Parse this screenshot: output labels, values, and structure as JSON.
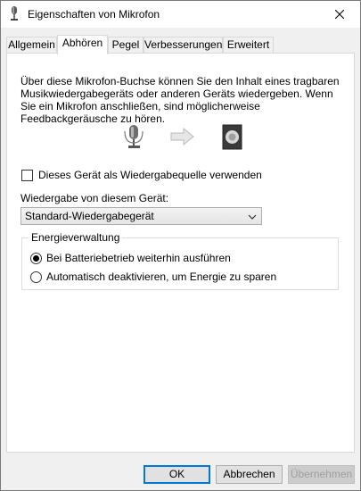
{
  "window": {
    "title": "Eigenschaften von Mikrofon",
    "icon": "microphone-icon",
    "close_icon": "close-icon"
  },
  "tabs": [
    {
      "label": "Allgemein",
      "active": false
    },
    {
      "label": "Abhören",
      "active": true
    },
    {
      "label": "Pegel",
      "active": false
    },
    {
      "label": "Verbesserungen",
      "active": false
    },
    {
      "label": "Erweitert",
      "active": false
    }
  ],
  "panel": {
    "description_line1": "Über diese Mikrofon-Buchse können Sie den Inhalt eines tragbaren",
    "description_line2": "Musikwiedergabegeräts oder anderen Geräts wiedergeben. Wenn",
    "description_line3": "Sie ein Mikrofon anschließen, sind möglicherweise",
    "description_line4": "Feedbackgeräusche zu hören.",
    "illustration": {
      "source_icon": "microphone-icon",
      "arrow_icon": "arrow-right-icon",
      "target_icon": "speaker-icon"
    },
    "checkbox_label": "Dieses Gerät als Wiedergabequelle verwenden",
    "checkbox_checked": false,
    "playback_label": "Wiedergabe von diesem Gerät:",
    "playback_selected": "Standard-Wiedergabegerät",
    "power": {
      "title": "Energieverwaltung",
      "option1": "Bei Batteriebetrieb weiterhin ausführen",
      "option2": "Automatisch deaktivieren, um Energie zu sparen",
      "selected": 1
    }
  },
  "buttons": {
    "ok": "OK",
    "cancel": "Abbrechen",
    "apply": "Übernehmen"
  },
  "colors": {
    "accent": "#0078d7",
    "panel_bg": "#ffffff",
    "window_bg": "#f0f0f0"
  }
}
